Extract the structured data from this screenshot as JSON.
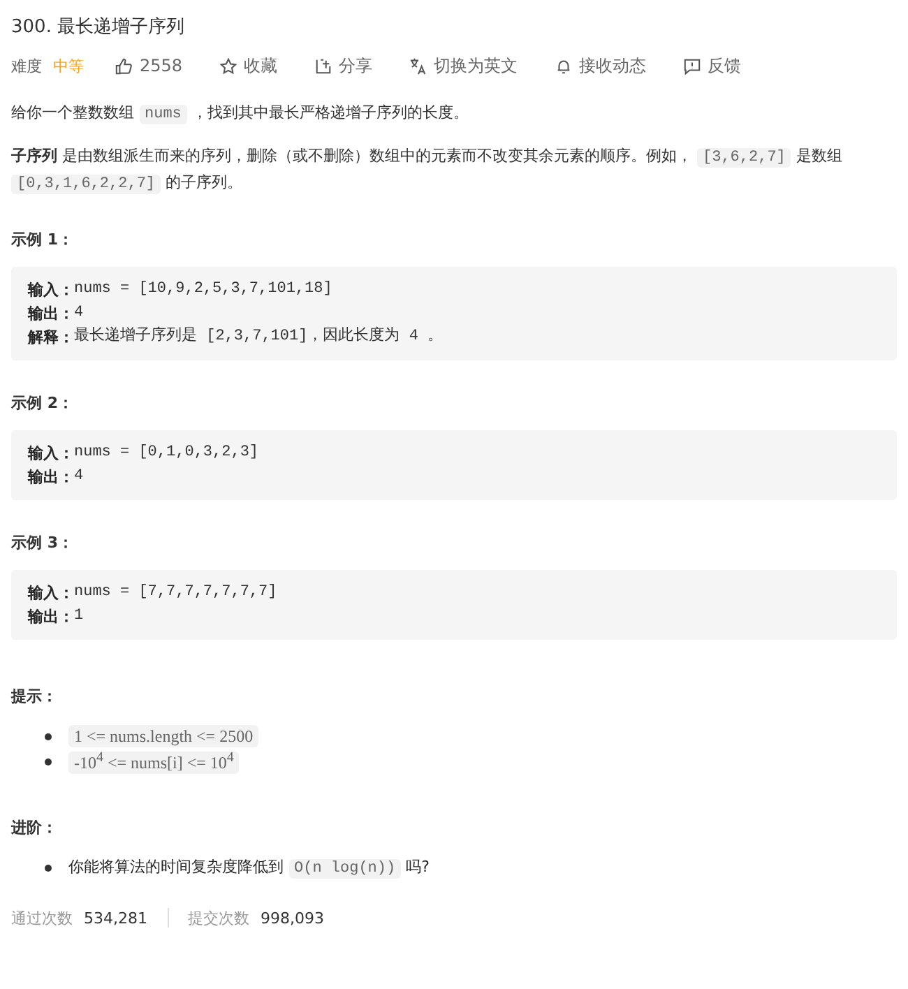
{
  "title": "300. 最长递增子序列",
  "toolbar": {
    "difficulty_label": "难度",
    "difficulty": "中等",
    "actions": [
      {
        "kind": "like",
        "label": "2558"
      },
      {
        "kind": "star",
        "label": "收藏"
      },
      {
        "kind": "share",
        "label": "分享"
      },
      {
        "kind": "translate",
        "label": "切换为英文"
      },
      {
        "kind": "bell",
        "label": "接收动态"
      },
      {
        "kind": "feedback",
        "label": "反馈"
      }
    ]
  },
  "description": [
    [
      {
        "kind": "text",
        "text": "给你一个整数数组 "
      },
      {
        "kind": "code",
        "text": "nums"
      },
      {
        "kind": "text",
        "text": " ，找到其中最长严格递增子序列的长度。"
      }
    ],
    [
      {
        "kind": "text",
        "text": "**子序列** 是由数组派生而来的序列，删除（或不删除）数组中的元素而不改变其余元素的顺序。例如， "
      },
      {
        "kind": "code",
        "text": "[3,6,2,7]"
      },
      {
        "kind": "text",
        "text": " 是数组 "
      },
      {
        "kind": "code",
        "text": "[0,3,1,6,2,2,7]"
      },
      {
        "kind": "text",
        "text": " 的子序列。"
      }
    ]
  ],
  "examples": [
    {
      "heading": "示例 1：",
      "lines": [
        {
          "label": "输入：",
          "value": "nums = [10,9,2,5,3,7,101,18]"
        },
        {
          "label": "输出：",
          "value": "4"
        },
        {
          "label": "解释：",
          "value": "最长递增子序列是 [2,3,7,101]，因此长度为 4 。"
        }
      ]
    },
    {
      "heading": "示例 2：",
      "lines": [
        {
          "label": "输入：",
          "value": "nums = [0,1,0,3,2,3]"
        },
        {
          "label": "输出：",
          "value": "4"
        }
      ]
    },
    {
      "heading": "示例 3：",
      "lines": [
        {
          "label": "输入：",
          "value": "nums = [7,7,7,7,7,7,7]"
        },
        {
          "label": "输出：",
          "value": "1"
        }
      ]
    }
  ],
  "hints": {
    "heading": "提示：",
    "items": [
      [
        {
          "kind": "code",
          "text": "1 <= nums.length <= 2500"
        }
      ],
      [
        {
          "kind": "code",
          "text": "-10$^{4}$ <= nums[i] <= 10$^{4}$"
        }
      ]
    ]
  },
  "advanced": {
    "heading": "进阶：",
    "items": [
      [
        {
          "kind": "text",
          "text": "你能将算法的时间复杂度降低到 "
        },
        {
          "kind": "code",
          "text": "O(n log(n))"
        },
        {
          "kind": "text",
          "text": " 吗?"
        }
      ]
    ]
  },
  "footer": [
    {
      "label": "通过次数",
      "value": "534,281"
    },
    {
      "label": "提交次数",
      "value": "998,093"
    }
  ]
}
